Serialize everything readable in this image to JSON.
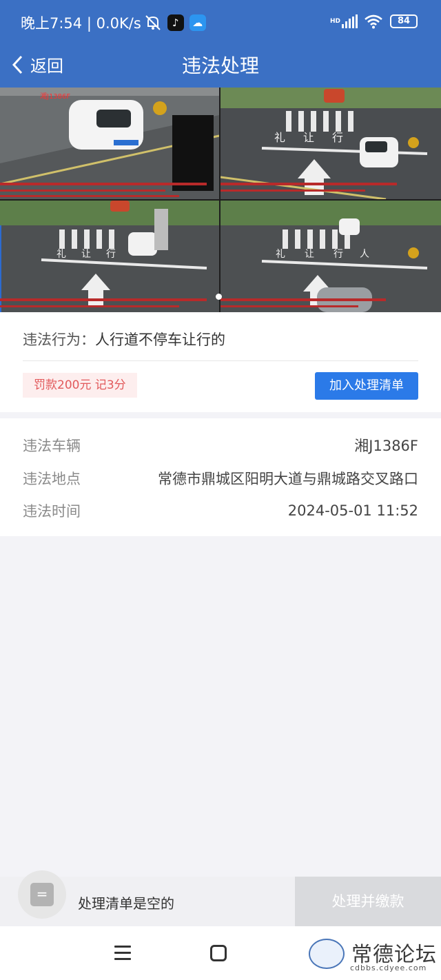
{
  "status": {
    "time_speed": "晚上7:54 | 0.0K/s",
    "hd": "HD",
    "battery": "84"
  },
  "nav": {
    "back_label": "返回",
    "title": "违法处理"
  },
  "photo": {
    "road_markings": [
      "礼",
      "让",
      "行",
      "人"
    ],
    "plate_caption": "湘J1386F"
  },
  "violation": {
    "behavior_label": "违法行为：",
    "behavior_value": "人行道不停车让行的",
    "penalty": "罚款200元 记3分",
    "add_button": "加入处理清单"
  },
  "details": {
    "vehicle_label": "违法车辆",
    "vehicle_value": "湘J1386F",
    "location_label": "违法地点",
    "location_value": "常德市鼎城区阳明大道与鼎城路交叉路口",
    "time_label": "违法时间",
    "time_value": "2024-05-01 11:52"
  },
  "bottom": {
    "cart_icon_glyph": "=",
    "empty_text": "处理清单是空的",
    "pay_button": "处理并缴款"
  },
  "watermark": {
    "title": "常德论坛",
    "site": "cdbbs.cdyee.com"
  },
  "colors": {
    "primary": "#3b70c4",
    "button": "#2b7ae8",
    "penalty_text": "#e2595b",
    "penalty_bg": "#fdeeee"
  }
}
